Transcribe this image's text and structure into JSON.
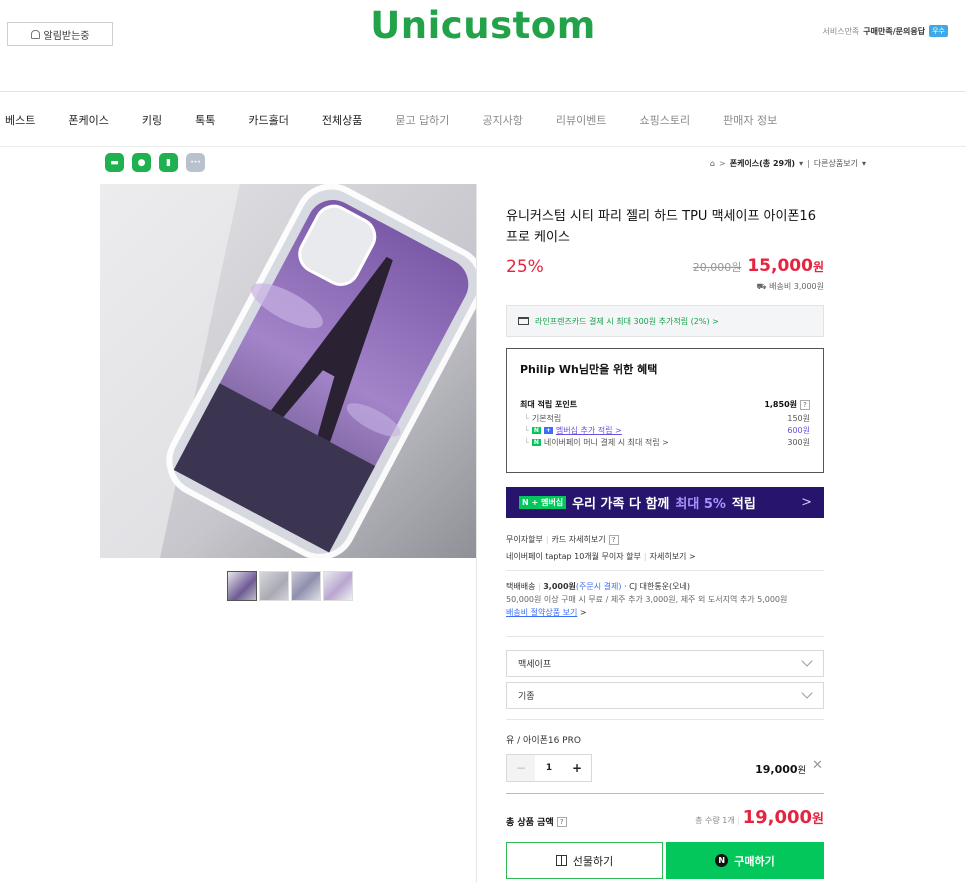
{
  "header": {
    "alarm_label": "알림받는중",
    "logo": "Unicustom",
    "service_label": "서비스만족",
    "service_value": "구매만족/문의응답",
    "service_badge": "우수"
  },
  "nav": {
    "items": [
      "베스트",
      "폰케이스",
      "키링",
      "톡톡",
      "카드홀더",
      "전체상품",
      "묻고 답하기",
      "공지사항",
      "리뷰이벤트",
      "쇼핑스토리",
      "판매자 정보"
    ]
  },
  "breadcrumb": {
    "home_icon": "home-icon",
    "category": "폰케이스(총 29개)",
    "other": "다른상품보기"
  },
  "share_icons": [
    "line-icon",
    "share-icon",
    "bookmark-icon",
    "more-icon"
  ],
  "product": {
    "title": "유니커스텀 시티 파리 젤리 하드 TPU 맥세이프 아이폰16 프로 케이스",
    "discount": "25%",
    "original_price": "20,000원",
    "sale_price": "15,000",
    "sale_unit": "원",
    "shipping_fee": "배송비 3,000원"
  },
  "card_promo": "라인프렌즈카드 결제 시 최대 300원 추가적립 (2%) >",
  "benefit": {
    "title": "Philip Wh님만을 위한 혜택",
    "max_label": "최대 적립 포인트",
    "max_value": "1,850원",
    "rows": [
      {
        "label": "기본적립",
        "value": "150원"
      },
      {
        "label": "멤버십 추가 적립 >",
        "value": "600원"
      },
      {
        "label": "네이버페이 머니 결제 시 최대 적립 >",
        "value": "300원"
      }
    ]
  },
  "banner": {
    "badge": "N + 멤버십",
    "text_before": "우리 가족 다 함께",
    "highlight": "최대 5%",
    "text_after": "적립",
    "arrow": ">"
  },
  "installment": {
    "label": "무이자할부",
    "detail": "카드 자세히보기",
    "naver": "네이버페이 taptap 10개월 무이자 할부",
    "naver_detail": "자세히보기 >"
  },
  "shipping": {
    "label": "택배배송",
    "price": "3,000원",
    "price_note": "(주문시 결제)",
    "courier": "· CJ 대한통운(오네)",
    "note": "50,000원 이상 구매 시 무료 / 제주 추가 3,000원, 제주 외 도서지역 추가 5,000원",
    "link": "배송비 절약상품 보기"
  },
  "options": {
    "select1": "맥세이프",
    "select2": "기종",
    "selected_name": "유 / 아이폰16 PRO",
    "qty": "1",
    "line_price": "19,000",
    "line_unit": "원"
  },
  "total": {
    "label": "총 상품 금액",
    "qty_text": "총 수량 1개",
    "price": "19,000",
    "unit": "원"
  },
  "buttons": {
    "gift": "선물하기",
    "buy": "구매하기"
  }
}
